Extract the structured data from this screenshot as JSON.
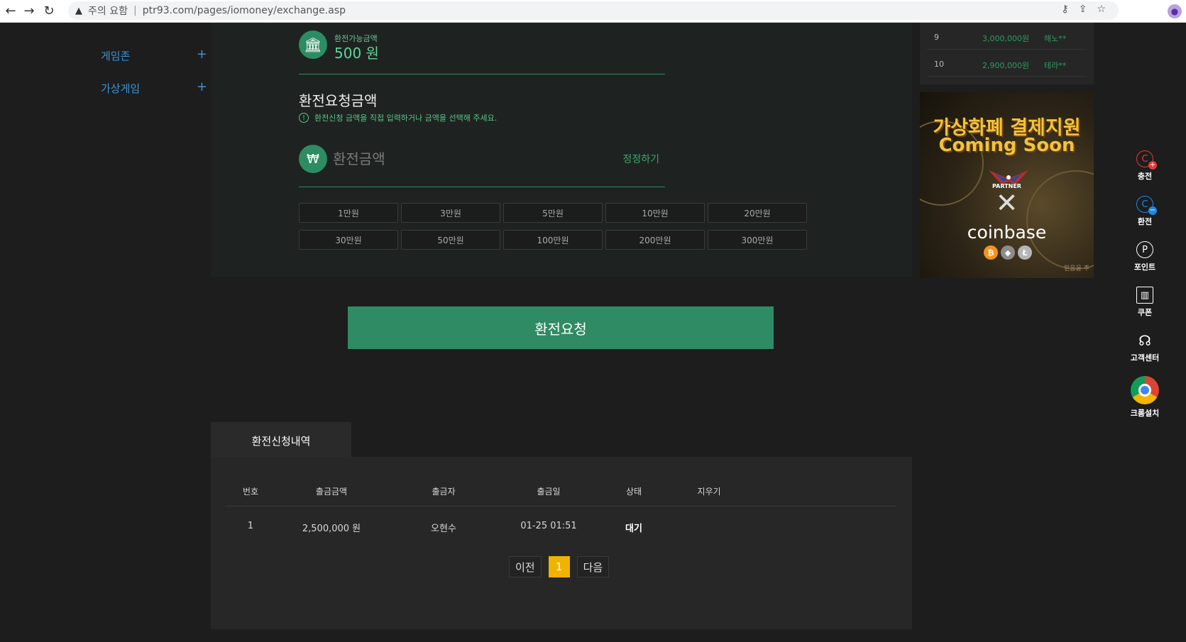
{
  "browser": {
    "warning_label": "주의 요함",
    "url": "ptr93.com/pages/iomoney/exchange.asp"
  },
  "leftmenu": {
    "items": [
      {
        "label": "게임존"
      },
      {
        "label": "가상게임"
      }
    ],
    "plus_symbol": "+"
  },
  "available": {
    "label": "환전가능금액",
    "value": "500 원"
  },
  "request": {
    "title": "환전요청금액",
    "hint": "환전신청 금액을 직접 입력하거나 금액을 선택해 주세요.",
    "hint_icon": "!",
    "currency_symbol": "₩",
    "amount_placeholder": "환전금액",
    "correct_label": "정정하기",
    "amount_buttons": [
      "1만원",
      "3만원",
      "5만원",
      "10만원",
      "20만원",
      "30만원",
      "50만원",
      "100만원",
      "200만원",
      "300만원"
    ]
  },
  "submit_label": "환전요청",
  "history": {
    "tab_label": "환전신청내역",
    "headers": {
      "no": "번호",
      "amount": "출금금액",
      "name": "출금자",
      "date": "출금일",
      "status": "상태",
      "delete": "지우기"
    },
    "rows": [
      {
        "no": "1",
        "amount": "2,500,000 원",
        "name": "오현수",
        "date": "01-25 01:51",
        "status": "대기"
      }
    ],
    "pager": {
      "prev": "이전",
      "current": "1",
      "next": "다음"
    }
  },
  "ranking": [
    {
      "rank": "9",
      "amount": "3,000,000원",
      "name": "해노**"
    },
    {
      "rank": "10",
      "amount": "2,900,000원",
      "name": "테라**"
    }
  ],
  "ad": {
    "title_line1": "가상화폐 결제지원",
    "title_line2": "Coming Soon",
    "partner": "PARTNER",
    "cross": "✕",
    "brand": "coinbase",
    "corner_text": "믿음을 주"
  },
  "quick_menu": [
    {
      "label": "충전",
      "icon": "C",
      "badge": "+"
    },
    {
      "label": "환전",
      "icon": "C",
      "badge": "−"
    },
    {
      "label": "포인트",
      "icon": "P"
    },
    {
      "label": "쿠폰",
      "icon": "▥"
    },
    {
      "label": "고객센터",
      "icon": "☊"
    },
    {
      "label": "크롬설치"
    }
  ],
  "colors": {
    "accent_green": "#2f8b64",
    "link_blue": "#3c93d8",
    "pager_active": "#f0b400"
  }
}
